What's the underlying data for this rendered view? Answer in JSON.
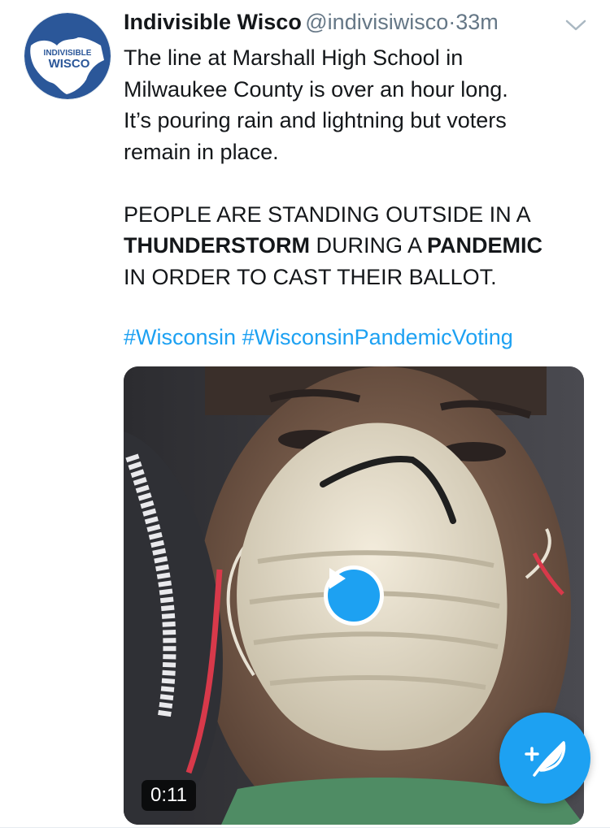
{
  "tweet": {
    "author_name": "Indivisible Wisco",
    "handle": "@indivisiwisco",
    "separator": "·",
    "time": "33m",
    "avatar_text": {
      "line1": "INDIVISIBLE",
      "line2": "WISCO"
    },
    "line1": "The line at Marshall High School in",
    "line2": "Milwaukee County is over an hour long.",
    "line3": "It’s pouring rain and lightning but voters",
    "line4": "remain in place.",
    "caps_line1": "PEOPLE ARE STANDING OUTSIDE IN A",
    "caps_bold1": "THUNDERSTORM",
    "caps_mid": " DURING A ",
    "caps_bold2": "PANDEMIC",
    "caps_line3": "IN ORDER TO CAST THEIR BALLOT.",
    "hashtags": [
      "#Wisconsin",
      "#WisconsinPandemicVoting"
    ]
  },
  "media": {
    "type": "video",
    "duration": "0:11",
    "play_icon": "play-icon"
  },
  "compose": {
    "icon": "compose-tweet-icon"
  },
  "colors": {
    "accent": "#1da1f2",
    "text": "#14171a",
    "secondary": "#657786",
    "avatar_blue": "#2b5799"
  }
}
